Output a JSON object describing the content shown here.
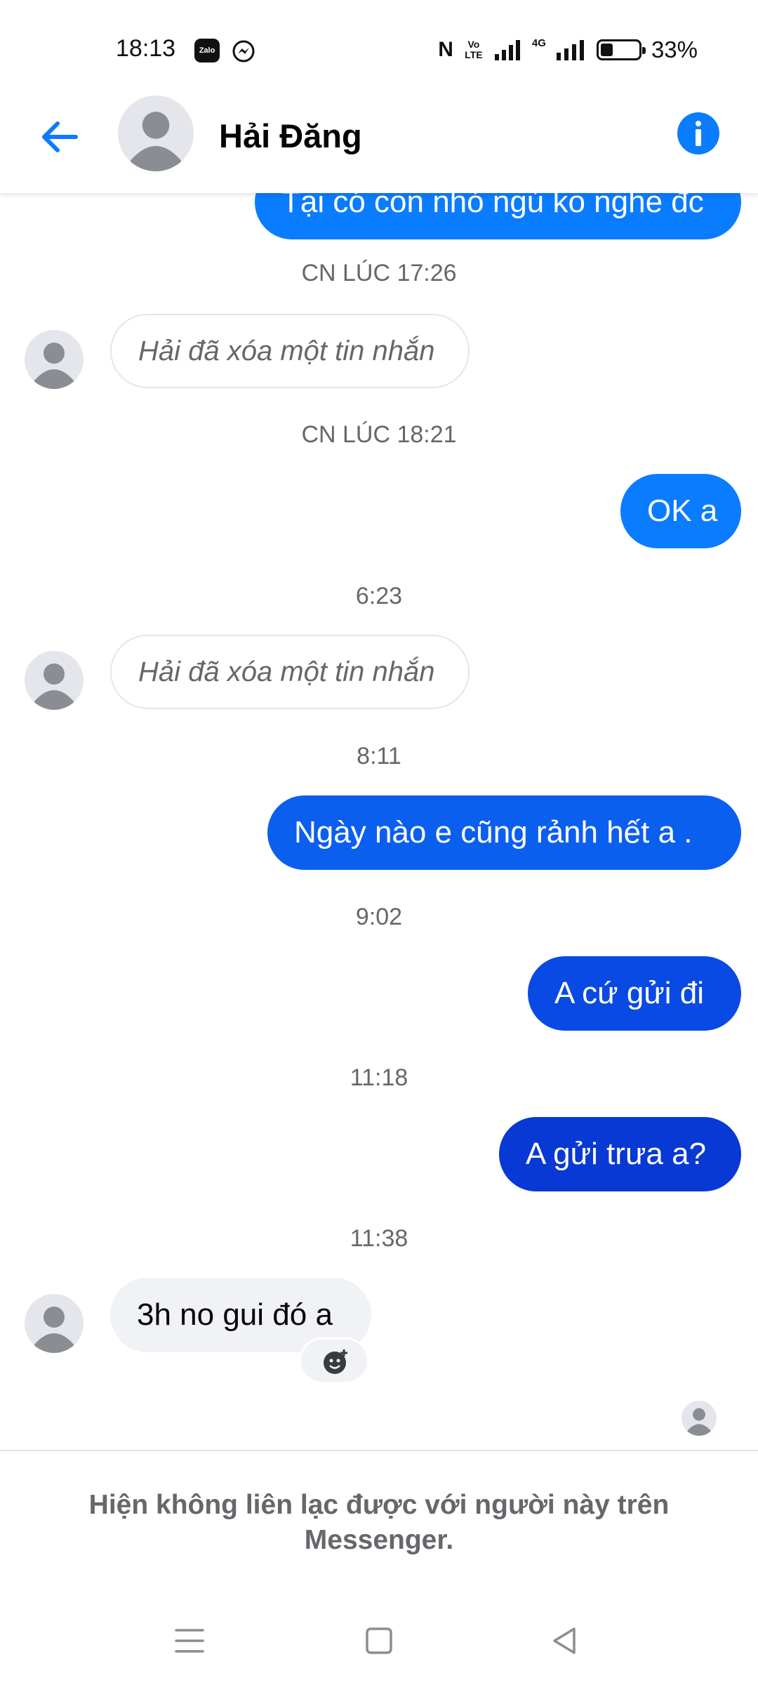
{
  "status_bar": {
    "time": "18:13",
    "zalo_label": "Zalo",
    "volte_label": "Vo LTE",
    "network_label": "4G",
    "battery_percent": "33%",
    "battery_level": 0.33
  },
  "header": {
    "contact_name": "Hải Đăng",
    "accent_color": "#0a7cff"
  },
  "messages": {
    "partial_top_text": "Tại có con nhỏ ngủ ko nghe đc",
    "stamp_1": "CN LÚC 17:26",
    "deleted_1": "Hải đã xóa một tin nhắn",
    "stamp_2": "CN LÚC 18:21",
    "out_1": "OK a",
    "stamp_3": "6:23",
    "deleted_2": "Hải đã xóa một tin nhắn",
    "stamp_4": "8:11",
    "out_2": "Ngày nào e cũng rảnh hết a .",
    "stamp_5": "9:02",
    "out_3": "A cứ gửi đi",
    "stamp_6": "11:18",
    "out_4": "A gửi trưa a?",
    "stamp_7": "11:38",
    "in_1": "3h no gui đó a"
  },
  "notice": {
    "text": "Hiện không liên lạc được với người này trên Messenger."
  },
  "icons": {
    "back": "arrow-left",
    "info": "info-circle",
    "reaction": "smiley-plus",
    "nav_menu": "three-lines",
    "nav_home": "square",
    "nav_back": "triangle-left"
  }
}
